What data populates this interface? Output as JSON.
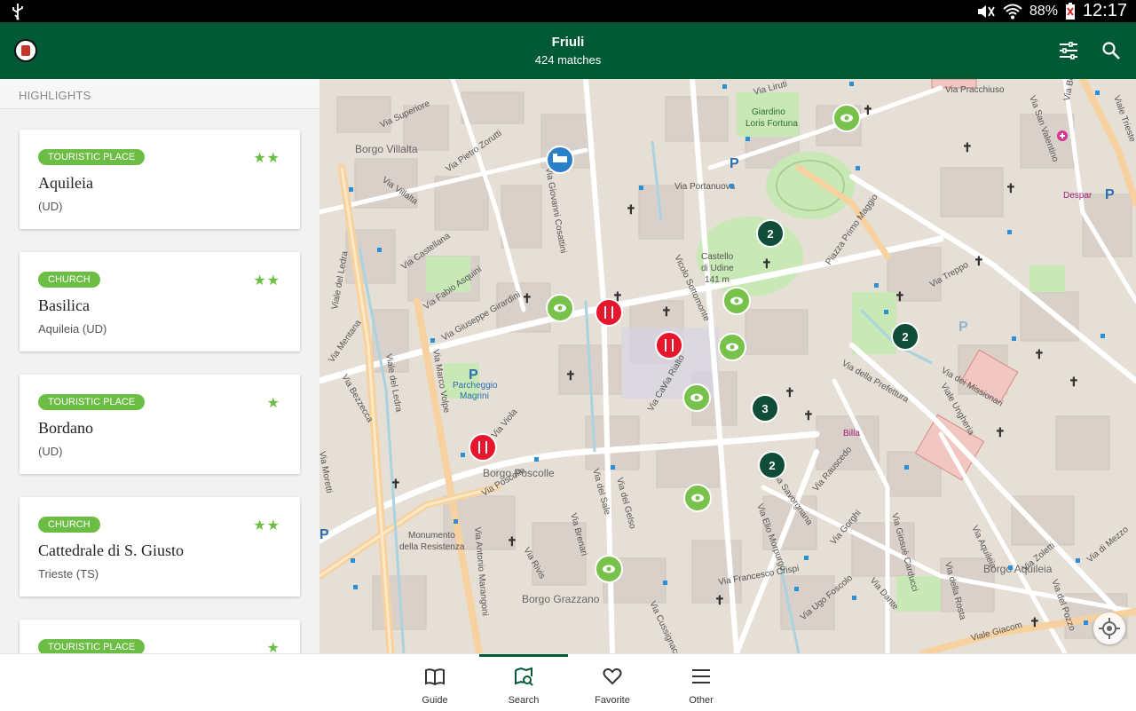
{
  "status_bar": {
    "battery": "88%",
    "time": "12:17"
  },
  "app_bar": {
    "title": "Friuli",
    "subtitle": "424 matches"
  },
  "left_panel": {
    "section_title": "HIGHLIGHTS",
    "cards": [
      {
        "category": "TOURISTIC PLACE",
        "stars": "★★",
        "name": "Aquileia",
        "location": " (UD)"
      },
      {
        "category": "CHURCH",
        "stars": "★★",
        "name": "Basilica",
        "location": "Aquileia (UD)"
      },
      {
        "category": "TOURISTIC PLACE",
        "stars": "★",
        "name": "Bordano",
        "location": " (UD)"
      },
      {
        "category": "CHURCH",
        "stars": "★★",
        "name": "Cattedrale di S. Giusto",
        "location": "Trieste (TS)"
      },
      {
        "category": "TOURISTIC PLACE",
        "stars": "★",
        "name": "",
        "location": ""
      }
    ]
  },
  "map": {
    "labels": {
      "borgo_villalta": "Borgo Villalta",
      "via_superiore": "Via Superiore",
      "via_pietro_zorutti": "Via Pietro Zorutti",
      "via_villalta": "Via Villalta",
      "viale_del_ledra": "Viale del Ledra",
      "via_castellana": "Via Castellana",
      "via_fabio_asquini": "Via Fabio Asquini",
      "via_giuseppe_girardini": "Via Giuseppe Girardini",
      "via_mentana": "Via Mentana",
      "via_bezzecca": "Via Bezzecca",
      "via_marco_volpe": "Via Marco Volpe",
      "parcheggio": "Parcheggio",
      "magrini": "Magrini",
      "borgo_poscolle": "Borgo Poscolle",
      "via_poscolle": "Via Poscolle",
      "monumento": "Monumento",
      "della_resistenza": "della Resistenza",
      "via_antonio_marangoni": "Via Antonio Marangoni",
      "borgo_grazzano": "Borgo Grazzano",
      "via_portanuova": "Via Portanuova",
      "giardino": "Giardino",
      "loris_fortuna": "Loris Fortuna",
      "via_liruti": "Via Liruti",
      "via_pracchiuso": "Via Pracchiuso",
      "castello": "Castello",
      "di_udine": "di Udine",
      "elevation": "141 m",
      "vicolo_sottomonte": "Vicolo Sottomonte",
      "piazza_primo_maggio": "Piazza Primo Maggio",
      "via_della_prefettura": "Via della Prefettura",
      "viale_ungheria": "Viale Ungheria",
      "via_dei_missionari": "Via dei Missionari",
      "borgo_aquileia": "Borgo Aquileia",
      "via_aquileia": "Via Aquileia",
      "via_francesco_crispi": "Via Francesco Crispi",
      "via_ugo_foscolo": "Via Ugo Foscolo",
      "viale_giacomo": "Viale Giacom",
      "via_treppo": "Via Treppo",
      "via_rialto": "Via Rialto",
      "via_cavour": "Via Cav",
      "billa": "Billa",
      "despar": "Despar",
      "via_san_valentino": "Via San Valentino",
      "via_bersaglio": "Via Bersaglio",
      "viale_trieste": "Viale Trieste",
      "via_gorghi": "Via Gorghi",
      "via_dante": "Via Dante",
      "via_giosue_carducci": "Via Giosuè Carducci",
      "via_della_rosta": "Via della Rosta",
      "via_del_pozzo": "Via del Pozzo",
      "via_zoletti": "Via Zoletti",
      "via_di_mezzo": "Via di Mezzo",
      "via_rivis": "Via Rivis",
      "via_brenari": "Via Brenari",
      "via_del_sale": "Via del Sale",
      "via_gelso": "Via del Gelso",
      "via_elio_morpurgo": "Via Elio Morpurgo",
      "via_savorgnana": "Via Savorgnana",
      "via_rauscedo": "Via Rauscedo",
      "via_cussignacco": "Via Cussignacco",
      "via_giovanni_cosattini": "Via Giovanni Cosattini",
      "via_viola": "Via Viola",
      "via_moretti": "Via Moretti"
    },
    "clusters": [
      "2",
      "2",
      "3",
      "2"
    ]
  },
  "bottom_nav": {
    "items": [
      {
        "label": "Guide"
      },
      {
        "label": "Search"
      },
      {
        "label": "Favorite"
      },
      {
        "label": "Other"
      }
    ]
  },
  "colors": {
    "primary": "#005a35",
    "accent_green": "#6cbd44",
    "poi_red": "#e8162d",
    "cluster": "#0f4d39",
    "hotel_blue": "#2980c9"
  }
}
